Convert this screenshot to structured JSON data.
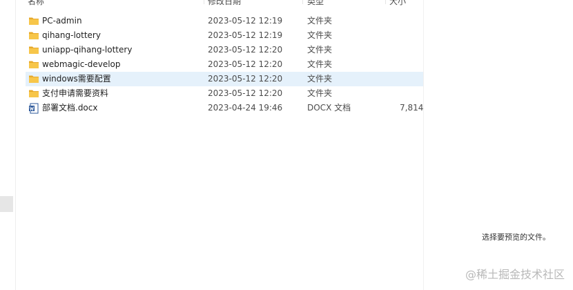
{
  "columns": {
    "name": "名称",
    "date": "修改日期",
    "type": "类型",
    "size": "大小"
  },
  "files": [
    {
      "name": "PC-admin",
      "date": "2023-05-12 12:19",
      "type": "文件夹",
      "size": "",
      "icon": "folder-icon",
      "selected": false
    },
    {
      "name": "qihang-lottery",
      "date": "2023-05-12 12:19",
      "type": "文件夹",
      "size": "",
      "icon": "folder-icon",
      "selected": false
    },
    {
      "name": "uniapp-qihang-lottery",
      "date": "2023-05-12 12:20",
      "type": "文件夹",
      "size": "",
      "icon": "folder-icon",
      "selected": false
    },
    {
      "name": "webmagic-develop",
      "date": "2023-05-12 12:20",
      "type": "文件夹",
      "size": "",
      "icon": "folder-icon",
      "selected": false
    },
    {
      "name": "windows需要配置",
      "date": "2023-05-12 12:20",
      "type": "文件夹",
      "size": "",
      "icon": "folder-icon",
      "selected": true
    },
    {
      "name": "支付申请需要资料",
      "date": "2023-05-12 12:20",
      "type": "文件夹",
      "size": "",
      "icon": "folder-icon",
      "selected": false
    },
    {
      "name": "部署文档.docx",
      "date": "2023-04-24 19:46",
      "type": "DOCX 文档",
      "size": "7,814",
      "icon": "word-document-icon",
      "selected": false
    }
  ],
  "preview": {
    "message": "选择要预览的文件。"
  },
  "watermark": "@稀土掘金技术社区",
  "colors": {
    "folder": "#f7c64a",
    "folder_dark": "#e7a92a",
    "selection": "#e5f1fb",
    "word_blue": "#2b579a"
  }
}
